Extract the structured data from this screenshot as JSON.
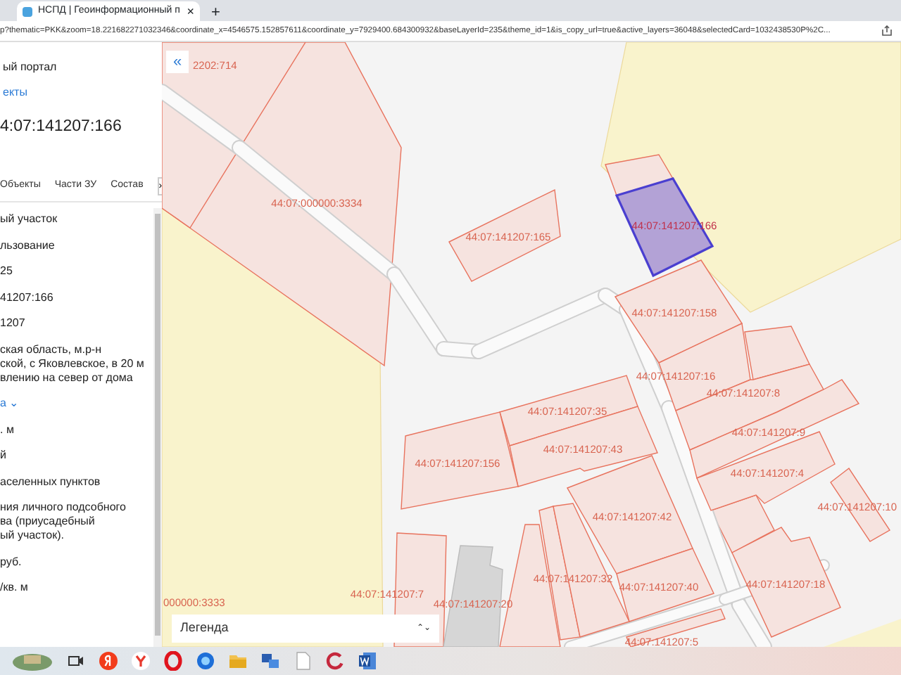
{
  "browser": {
    "tab_title": "НСПД | Геоинформационный п",
    "tab_close": "×",
    "new_tab": "+",
    "address": "p?thematic=PKK&zoom=18.221682271032346&coordinate_x=4546575.152857611&coordinate_y=7929400.684300932&baseLayerId=235&theme_id=1&is_copy_url=true&active_layers=36048&selectedCard=1032438530P%2C..."
  },
  "panel": {
    "header": "ый портал",
    "link": "екты",
    "title": "4:07:141207:166",
    "tabs": [
      {
        "label": "Объекты",
        "selected": false
      },
      {
        "label": "Части ЗУ",
        "selected": false
      },
      {
        "label": "Состав",
        "selected": false
      }
    ],
    "next_button": "›",
    "fields": [
      {
        "kind": "text",
        "lines": [
          "ый участок"
        ]
      },
      {
        "kind": "text",
        "lines": [
          "льзование"
        ]
      },
      {
        "kind": "text",
        "lines": [
          "25"
        ]
      },
      {
        "kind": "text",
        "lines": [
          "41207:166"
        ]
      },
      {
        "kind": "text",
        "lines": [
          "1207"
        ]
      },
      {
        "kind": "text",
        "lines": [
          "ская область, м.р-н",
          "ской, с Яковлевское, в 20 м",
          "влению на север от дома"
        ]
      },
      {
        "kind": "link",
        "lines": [
          "а ⌄"
        ]
      },
      {
        "kind": "text",
        "lines": [
          ". м"
        ]
      },
      {
        "kind": "text",
        "lines": [
          "й"
        ]
      },
      {
        "kind": "text",
        "lines": [
          "аселенных пунктов"
        ]
      },
      {
        "kind": "text",
        "lines": [
          "ния личного подсобного",
          "ва (приусадебный",
          "ый участок)."
        ]
      },
      {
        "kind": "text",
        "lines": [
          "руб."
        ]
      },
      {
        "kind": "text",
        "lines": [
          "/кв. м"
        ]
      }
    ]
  },
  "map": {
    "collapse_button": "«",
    "parcels": [
      {
        "label": "2202:714",
        "selected": false
      },
      {
        "label": "44:07:000000:3334",
        "selected": false
      },
      {
        "label": "44:07:141207:165",
        "selected": false
      },
      {
        "label": "44:07:141207:166",
        "selected": true
      },
      {
        "label": "44:07:141207:158",
        "selected": false
      },
      {
        "label": "44:07:141207:16",
        "selected": false
      },
      {
        "label": "44:07:141207:8",
        "selected": false
      },
      {
        "label": "44:07:141207:35",
        "selected": false
      },
      {
        "label": "44:07:141207:9",
        "selected": false
      },
      {
        "label": "44:07:141207:43",
        "selected": false
      },
      {
        "label": "44:07:141207:156",
        "selected": false
      },
      {
        "label": "44:07:141207:4",
        "selected": false
      },
      {
        "label": "44:07:141207:10",
        "selected": false
      },
      {
        "label": "44:07:141207:42",
        "selected": false
      },
      {
        "label": "44:07:141207:32",
        "selected": false
      },
      {
        "label": "44:07:141207:40",
        "selected": false
      },
      {
        "label": "44:07:141207:18",
        "selected": false
      },
      {
        "label": "44:07:141207:7",
        "selected": false
      },
      {
        "label": "44:07:141207:20",
        "selected": false
      },
      {
        "label": "000000:3333",
        "selected": false
      },
      {
        "label": "44:07:141207:5",
        "selected": false
      }
    ],
    "legend": {
      "label": "Легенда",
      "toggle": "⌃⌄"
    }
  }
}
